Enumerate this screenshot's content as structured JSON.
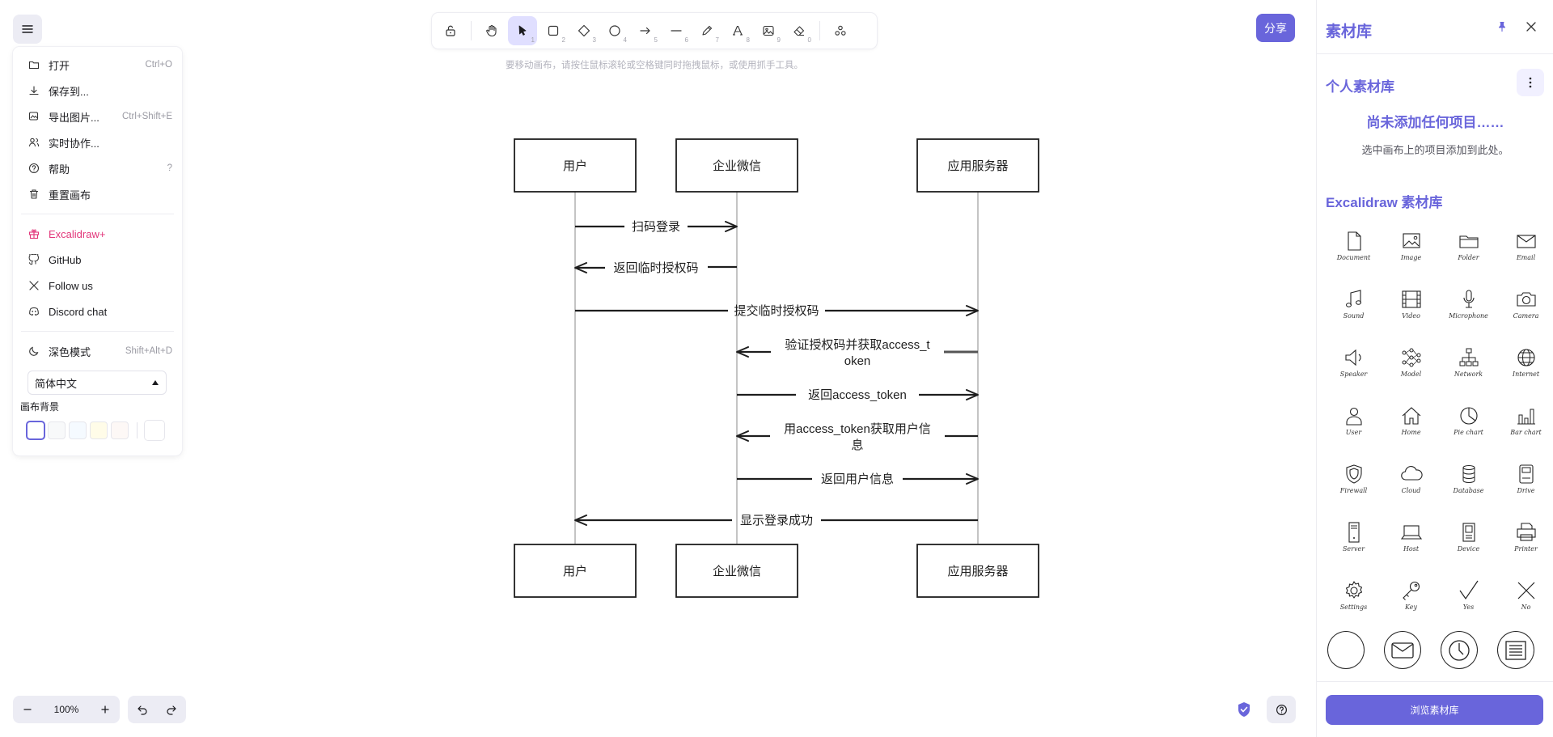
{
  "menu": {
    "items": [
      {
        "label": "打开",
        "shortcut": "Ctrl+O",
        "icon": "folder-icon"
      },
      {
        "label": "保存到...",
        "shortcut": "",
        "icon": "download-icon"
      },
      {
        "label": "导出图片...",
        "shortcut": "Ctrl+Shift+E",
        "icon": "export-image-icon"
      },
      {
        "label": "实时协作...",
        "shortcut": "",
        "icon": "users-icon"
      },
      {
        "label": "帮助",
        "shortcut": "?",
        "icon": "help-icon"
      },
      {
        "label": "重置画布",
        "shortcut": "",
        "icon": "trash-icon"
      }
    ],
    "links": [
      {
        "label": "Excalidraw+",
        "icon": "gift-icon"
      },
      {
        "label": "GitHub",
        "icon": "github-icon"
      },
      {
        "label": "Follow us",
        "icon": "x-logo-icon"
      },
      {
        "label": "Discord chat",
        "icon": "discord-icon"
      }
    ],
    "dark_mode": {
      "label": "深色模式",
      "shortcut": "Shift+Alt+D"
    },
    "language": "简体中文",
    "canvas_bg_label": "画布背景"
  },
  "toolbar": {
    "tools": [
      {
        "name": "lock",
        "key": ""
      },
      {
        "name": "hand",
        "key": ""
      },
      {
        "name": "selection",
        "key": "1"
      },
      {
        "name": "rectangle",
        "key": "2"
      },
      {
        "name": "diamond",
        "key": "3"
      },
      {
        "name": "ellipse",
        "key": "4"
      },
      {
        "name": "arrow",
        "key": "5"
      },
      {
        "name": "line",
        "key": "6"
      },
      {
        "name": "draw",
        "key": "7"
      },
      {
        "name": "text",
        "key": "8"
      },
      {
        "name": "image",
        "key": "9"
      },
      {
        "name": "eraser",
        "key": "0"
      },
      {
        "name": "extra-tools",
        "key": ""
      }
    ],
    "hint": "要移动画布，请按住鼠标滚轮或空格键同时拖拽鼠标，或使用抓手工具。"
  },
  "share": {
    "label": "分享"
  },
  "diagram": {
    "participants": [
      "用户",
      "企业微信",
      "应用服务器"
    ],
    "messages": [
      {
        "text": "扫码登录",
        "from": 0,
        "to": 1
      },
      {
        "text": "返回临时授权码",
        "from": 1,
        "to": 0
      },
      {
        "text": "提交临时授权码",
        "from": 0,
        "to": 2
      },
      {
        "text": "验证授权码并获取access_t",
        "text2": "oken",
        "from": 2,
        "to": 1
      },
      {
        "text": "返回access_token",
        "from": 1,
        "to": 2
      },
      {
        "text": "用access_token获取用户信",
        "text2": "息",
        "from": 2,
        "to": 1
      },
      {
        "text": "返回用户信息",
        "from": 1,
        "to": 2
      },
      {
        "text": "显示登录成功",
        "from": 2,
        "to": 0
      }
    ]
  },
  "library": {
    "title": "素材库",
    "personal_title": "个人素材库",
    "empty_title": "尚未添加任何项目……",
    "empty_sub": "选中画布上的项目添加到此处。",
    "excalidraw_title": "Excalidraw 素材库",
    "items": [
      "Document",
      "Image",
      "Folder",
      "Email",
      "Sound",
      "Video",
      "Microphone",
      "Camera",
      "Speaker",
      "Model",
      "Network",
      "Internet",
      "User",
      "Home",
      "Pie chart",
      "Bar chart",
      "Firewall",
      "Cloud",
      "Database",
      "Drive",
      "Server",
      "Host",
      "Device",
      "Printer",
      "Settings",
      "Key",
      "Yes",
      "No"
    ],
    "browse_label": "浏览素材库"
  },
  "footer": {
    "zoom": "100%"
  },
  "colors": {
    "accent": "#6965db",
    "accent_light": "#e0dfff",
    "pink": "#e2367a"
  }
}
